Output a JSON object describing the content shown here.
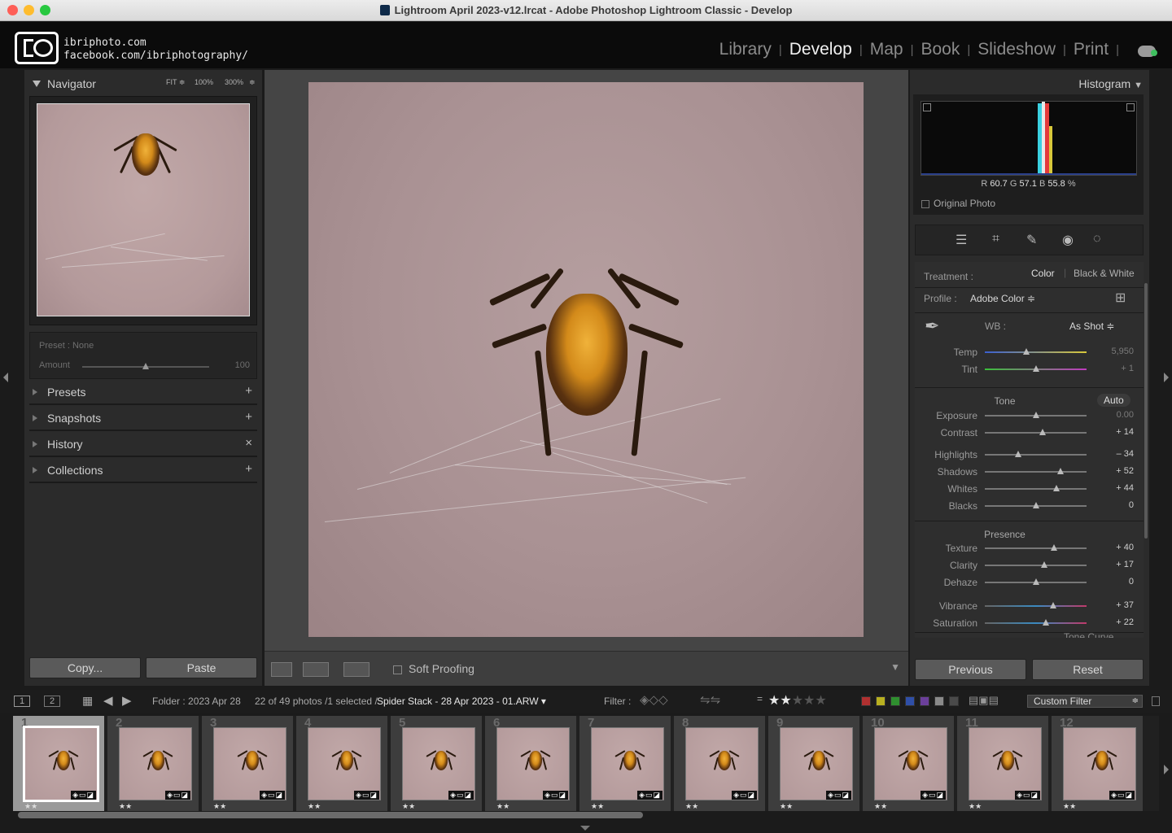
{
  "window": {
    "title": "Lightroom April 2023-v12.lrcat - Adobe Photoshop Lightroom Classic - Develop"
  },
  "identity": {
    "line1": "ibriphoto.com",
    "line2": "facebook.com/ibriphotography/"
  },
  "modules": [
    {
      "label": "Library",
      "active": false
    },
    {
      "label": "Develop",
      "active": true
    },
    {
      "label": "Map",
      "active": false
    },
    {
      "label": "Book",
      "active": false
    },
    {
      "label": "Slideshow",
      "active": false
    },
    {
      "label": "Print",
      "active": false
    }
  ],
  "left": {
    "navigator": {
      "title": "Navigator",
      "zoom": [
        "FIT ≑",
        "100%",
        "300%",
        "≑"
      ]
    },
    "preset": {
      "label": "Preset : None",
      "amount_label": "Amount",
      "amount_value": "100",
      "amount": 100
    },
    "sections": [
      {
        "label": "Presets",
        "action": "+"
      },
      {
        "label": "Snapshots",
        "action": "+"
      },
      {
        "label": "History",
        "action": "×"
      },
      {
        "label": "Collections",
        "action": "+"
      }
    ],
    "copy_label": "Copy...",
    "paste_label": "Paste"
  },
  "center": {
    "soft_proofing": "Soft Proofing"
  },
  "right": {
    "histogram": {
      "title": "Histogram",
      "r_label": "R",
      "r": "60.7",
      "g_label": "G",
      "g": "57.1",
      "b_label": "B",
      "b": "55.8",
      "pct": "%",
      "original_photo": "Original Photo"
    },
    "basic": {
      "treatment_label": "Treatment :",
      "color": "Color",
      "bw": "Black & White",
      "profile_label": "Profile :",
      "profile_value": "Adobe Color ≑",
      "wb_label": "WB :",
      "wb_value": "As Shot ≑",
      "tone_label": "Tone",
      "auto": "Auto",
      "presence_label": "Presence",
      "next_panel": "Tone Curve",
      "sliders": [
        {
          "label": "Temp",
          "value": "5,950",
          "pos": 0.41
        },
        {
          "label": "Tint",
          "value": "+ 1",
          "pos": 0.5
        },
        {
          "label": "Exposure",
          "value": "0.00",
          "pos": 0.5
        },
        {
          "label": "Contrast",
          "value": "+ 14",
          "pos": 0.57
        },
        {
          "label": "Highlights",
          "value": "– 34",
          "pos": 0.33
        },
        {
          "label": "Shadows",
          "value": "+ 52",
          "pos": 0.74
        },
        {
          "label": "Whites",
          "value": "+ 44",
          "pos": 0.7
        },
        {
          "label": "Blacks",
          "value": "0",
          "pos": 0.5
        },
        {
          "label": "Texture",
          "value": "+ 40",
          "pos": 0.68
        },
        {
          "label": "Clarity",
          "value": "+ 17",
          "pos": 0.58
        },
        {
          "label": "Dehaze",
          "value": "0",
          "pos": 0.5
        },
        {
          "label": "Vibrance",
          "value": "+ 37",
          "pos": 0.67
        },
        {
          "label": "Saturation",
          "value": "+ 22",
          "pos": 0.6
        }
      ]
    },
    "previous_label": "Previous",
    "reset_label": "Reset"
  },
  "filterbar": {
    "view1": "1",
    "view2": "2",
    "folder": "Folder : 2023 Apr 28",
    "count": "22 of 49 photos /1 selected /",
    "filename": "Spider Stack - 28 Apr 2023 - 01.ARW ▾",
    "filter_label": "Filter :",
    "custom_filter": "Custom Filter",
    "rating": 2,
    "colors": [
      "#b03030",
      "#b8b020",
      "#2f8f2f",
      "#2f4fa8",
      "#6b3f9a",
      "#8a8a8a",
      "#4a4a4a"
    ]
  },
  "filmstrip": {
    "cells": [
      {
        "num": "1",
        "stars": "★★",
        "selected": true
      },
      {
        "num": "2",
        "stars": "★★",
        "selected": false
      },
      {
        "num": "3",
        "stars": "★★",
        "selected": false
      },
      {
        "num": "4",
        "stars": "★★",
        "selected": false
      },
      {
        "num": "5",
        "stars": "★★",
        "selected": false
      },
      {
        "num": "6",
        "stars": "★★",
        "selected": false
      },
      {
        "num": "7",
        "stars": "★★",
        "selected": false
      },
      {
        "num": "8",
        "stars": "★★",
        "selected": false
      },
      {
        "num": "9",
        "stars": "★★",
        "selected": false
      },
      {
        "num": "10",
        "stars": "★★",
        "selected": false
      },
      {
        "num": "11",
        "stars": "★★",
        "selected": false
      },
      {
        "num": "12",
        "stars": "★★",
        "selected": false
      }
    ]
  }
}
